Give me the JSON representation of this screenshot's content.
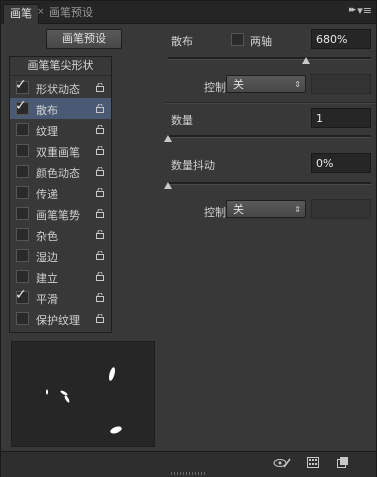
{
  "tabs": [
    {
      "label": "画笔",
      "active": true
    },
    {
      "label": "画笔预设",
      "active": false
    }
  ],
  "tab_close_glyph": "×",
  "tab_controls": {
    "collapse_glyph": "▸▸",
    "menu_glyph": "▾≡"
  },
  "brush_presets_button": "画笔预设",
  "list": {
    "header": "画笔笔尖形状",
    "items": [
      {
        "label": "形状动态",
        "checked": true,
        "selected": false
      },
      {
        "label": "散布",
        "checked": true,
        "selected": true
      },
      {
        "label": "纹理",
        "checked": false,
        "selected": false
      },
      {
        "label": "双重画笔",
        "checked": false,
        "selected": false
      },
      {
        "label": "颜色动态",
        "checked": false,
        "selected": false
      },
      {
        "label": "传递",
        "checked": false,
        "selected": false
      },
      {
        "label": "画笔笔势",
        "checked": false,
        "selected": false
      },
      {
        "label": "杂色",
        "checked": false,
        "selected": false
      },
      {
        "label": "湿边",
        "checked": false,
        "selected": false
      },
      {
        "label": "建立",
        "checked": false,
        "selected": false
      },
      {
        "label": "平滑",
        "checked": true,
        "selected": false
      },
      {
        "label": "保护纹理",
        "checked": false,
        "selected": false
      }
    ]
  },
  "scatter": {
    "label": "散布",
    "both_axes_label": "两轴",
    "both_axes_checked": false,
    "value": "680%",
    "control_label": "控制:",
    "control_value": "关"
  },
  "count": {
    "label": "数量",
    "value": "1"
  },
  "count_jitter": {
    "label": "数量抖动",
    "value": "0%",
    "control_label": "控制:",
    "control_value": "关"
  },
  "sliders": {
    "scatter_percent": 680,
    "count": 1,
    "count_jitter_percent": 0
  },
  "checkmark_glyph": "✓",
  "select_arrow_glyph": "⇕",
  "colors": {
    "panel_bg": "#383838",
    "selection": "#4a5a75",
    "field_bg": "#262626"
  }
}
